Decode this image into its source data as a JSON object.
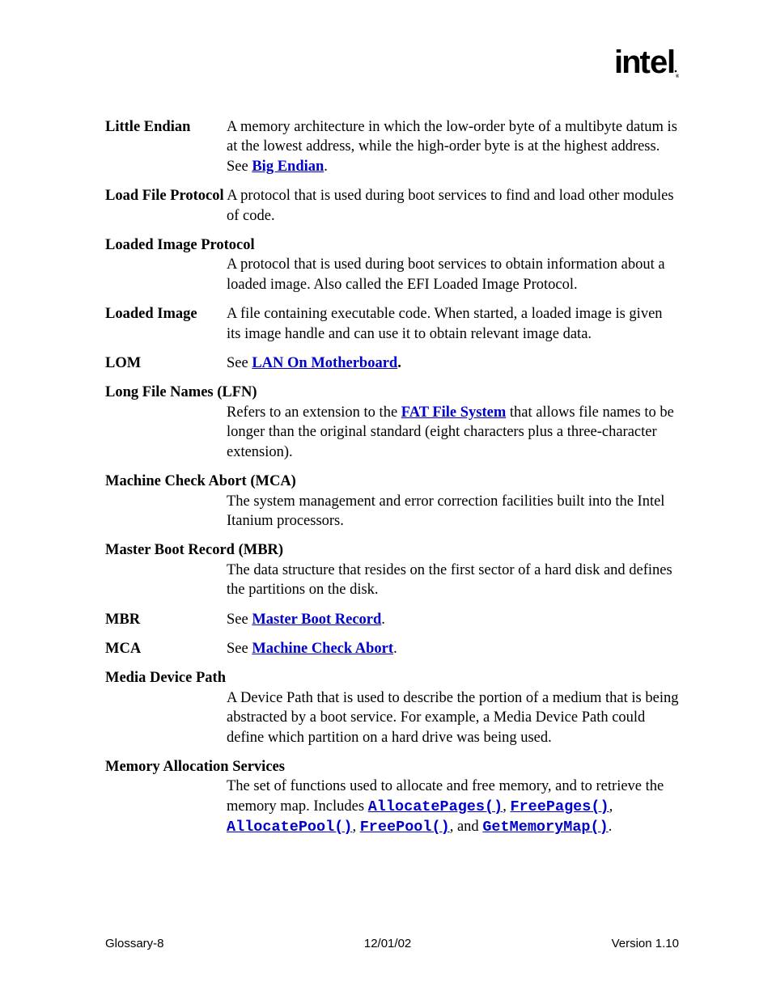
{
  "logo_text": "intel",
  "entries": {
    "little_endian": {
      "term": "Little Endian",
      "def_a": "A memory architecture in which the low-order byte of a multibyte datum is at the lowest address, while the high-order byte is at the highest address.  See ",
      "link": "Big Endian",
      "def_b": "."
    },
    "load_file": {
      "term": "Load File Protocol",
      "def": "A protocol that is used during boot services to find and load other modules of code."
    },
    "loaded_image_protocol": {
      "term": "Loaded Image Protocol",
      "def": "A protocol that is used during boot services to obtain information about a loaded image.  Also called the EFI Loaded Image Protocol."
    },
    "loaded_image": {
      "term": "Loaded Image",
      "def": "A file containing executable code.  When started, a loaded image is given its image handle and can use it to obtain relevant image data."
    },
    "lom": {
      "term": "LOM",
      "def_a": "See ",
      "link": "LAN On Motherboard",
      "def_b": "."
    },
    "lfn": {
      "term": "Long File Names (LFN)",
      "def_a": "Refers to an extension to the ",
      "link": "FAT File System",
      "def_b": " that allows file names to be longer than the original standard (eight characters plus a three-character extension)."
    },
    "mca": {
      "term": "Machine Check Abort (MCA)",
      "def": "The system management and error correction facilities built into the Intel Itanium processors."
    },
    "mbr": {
      "term": "Master Boot Record (MBR)",
      "def": "The data structure that resides on the first sector of a hard disk and defines the partitions on the disk."
    },
    "mbr_ref": {
      "term": "MBR",
      "def_a": "See ",
      "link": "Master Boot Record",
      "def_b": "."
    },
    "mca_ref": {
      "term": "MCA",
      "def_a": "See ",
      "link": "Machine Check Abort",
      "def_b": "."
    },
    "media_device": {
      "term": "Media Device Path",
      "def": "A Device Path that is used to describe the portion of a medium that is being abstracted by a boot service.  For example, a Media Device Path could define which partition on a hard drive was being used."
    },
    "mem_alloc": {
      "term": "Memory Allocation Services",
      "def_a": "The set of functions used to allocate and free memory, and to retrieve the memory map.  Includes ",
      "c1": "AllocatePages()",
      "s1": ", ",
      "c2": "FreePages()",
      "s2": ", ",
      "c3": "AllocatePool()",
      "s3": ", ",
      "c4": "FreePool()",
      "s4": ", and ",
      "c5": "GetMemoryMap()",
      "s5": "."
    }
  },
  "footer": {
    "left": "Glossary-8",
    "center": "12/01/02",
    "right": "Version 1.10"
  }
}
